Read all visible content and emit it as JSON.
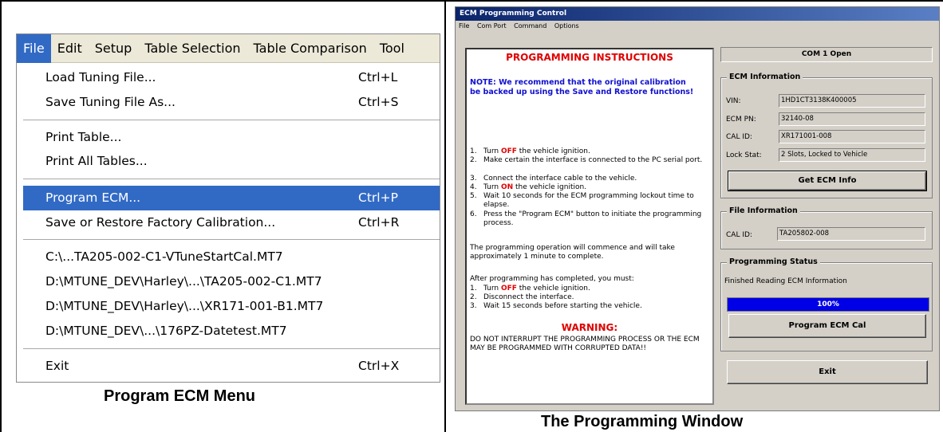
{
  "file_menu": {
    "menubar": [
      "File",
      "Edit",
      "Setup",
      "Table Selection",
      "Table Comparison",
      "Tool"
    ],
    "items": [
      {
        "label": "Load Tuning File...",
        "shortcut": "Ctrl+L"
      },
      {
        "label": "Save Tuning File As...",
        "shortcut": "Ctrl+S"
      },
      {
        "label": "Print Table...",
        "shortcut": ""
      },
      {
        "label": "Print All Tables...",
        "shortcut": ""
      },
      {
        "label": "Program ECM...",
        "shortcut": "Ctrl+P"
      },
      {
        "label": "Save or Restore Factory Calibration...",
        "shortcut": "Ctrl+R"
      },
      {
        "label": "C:\\...TA205-002-C1-VTuneStartCal.MT7",
        "shortcut": ""
      },
      {
        "label": "D:\\MTUNE_DEV\\Harley\\...\\TA205-002-C1.MT7",
        "shortcut": ""
      },
      {
        "label": "D:\\MTUNE_DEV\\Harley\\...\\XR171-001-B1.MT7",
        "shortcut": ""
      },
      {
        "label": "D:\\MTUNE_DEV\\...\\176PZ-Datetest.MT7",
        "shortcut": ""
      },
      {
        "label": "Exit",
        "shortcut": "Ctrl+X"
      }
    ],
    "caption": "Program ECM Menu"
  },
  "prog_window": {
    "title": "ECM Programming Control",
    "menubar": [
      "File",
      "Com Port",
      "Command",
      "Options"
    ],
    "instructions": {
      "title": "PROGRAMMING INSTRUCTIONS",
      "note": "NOTE: We recommend that the original calibration be backed up using the Save and Restore functions!",
      "steps": [
        {
          "num": "1.",
          "pre": "Turn ",
          "em": "OFF",
          "post": " the vehicle ignition."
        },
        {
          "num": "2.",
          "pre": "Make certain the interface is connected to the PC serial port.",
          "em": "",
          "post": ""
        },
        {
          "num": "3.",
          "pre": "Connect the interface cable to the vehicle.",
          "em": "",
          "post": ""
        },
        {
          "num": "4.",
          "pre": "Turn ",
          "em": "ON",
          "post": " the vehicle ignition."
        },
        {
          "num": "5.",
          "pre": "Wait 10 seconds for the ECM programming lockout time to elapse.",
          "em": "",
          "post": ""
        },
        {
          "num": "6.",
          "pre": "Press the \"Program ECM\" button to initiate the programming process.",
          "em": "",
          "post": ""
        }
      ],
      "commence": "The programming operation will commence and will take approximately 1 minute to complete.",
      "after": "After programming has completed, you must:",
      "after_steps": [
        {
          "num": "1.",
          "pre": "Turn ",
          "em": "OFF",
          "post": " the vehicle ignition."
        },
        {
          "num": "2.",
          "pre": "Disconnect the interface.",
          "em": "",
          "post": ""
        },
        {
          "num": "3.",
          "pre": "Wait 15 seconds before starting the vehicle.",
          "em": "",
          "post": ""
        }
      ],
      "warning_title": "WARNING:",
      "warning_text": "DO NOT INTERRUPT THE PROGRAMMING PROCESS OR THE ECM MAY BE PROGRAMMED WITH CORRUPTED DATA!!"
    },
    "com_status": "COM 1 Open",
    "ecm_info": {
      "title": "ECM Information",
      "fields": [
        {
          "label": "VIN:",
          "value": "1HD1CT3138K400005"
        },
        {
          "label": "ECM PN:",
          "value": "32140-08"
        },
        {
          "label": "CAL ID:",
          "value": "XR171001-008"
        },
        {
          "label": "Lock Stat:",
          "value": "2 Slots, Locked to Vehicle"
        }
      ],
      "button": "Get ECM Info"
    },
    "file_info": {
      "title": "File Information",
      "label": "CAL ID:",
      "value": "TA205802-008"
    },
    "prog_status": {
      "title": "Programming Status",
      "text": "Finished Reading ECM Information",
      "progress_label": "100%",
      "progress": 1.0,
      "button": "Program ECM Cal"
    },
    "exit_button": "Exit",
    "caption": "The Programming Window"
  }
}
